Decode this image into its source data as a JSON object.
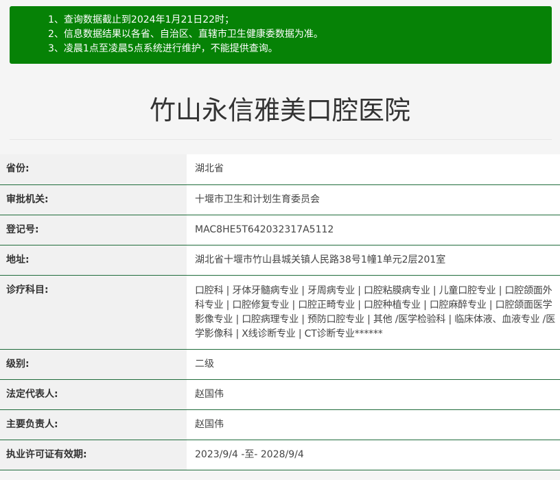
{
  "notice": {
    "lines": [
      "1、查询数据截止到2024年1月21日22时；",
      "2、信息数据结果以各省、自治区、直辖市卫生健康委数据为准。",
      "3、凌晨1点至凌晨5点系统进行维护，不能提供查询。"
    ]
  },
  "title": "竹山永信雅美口腔医院",
  "rows": [
    {
      "label": "省份:",
      "value": "湖北省"
    },
    {
      "label": "审批机关:",
      "value": "十堰市卫生和计划生育委员会"
    },
    {
      "label": "登记号:",
      "value": "MAC8HE5T642032317A5112"
    },
    {
      "label": "地址:",
      "value": "湖北省十堰市竹山县城关镇人民路38号1幢1单元2层201室"
    },
    {
      "label": "诊疗科目:",
      "value": "口腔科 | 牙体牙髓病专业 | 牙周病专业 | 口腔粘膜病专业 | 儿童口腔专业 | 口腔颌面外科专业 | 口腔修复专业 | 口腔正畸专业 | 口腔种植专业 | 口腔麻醉专业 | 口腔颌面医学影像专业 | 口腔病理专业 | 预防口腔专业 | 其他 /医学检验科 | 临床体液、血液专业 /医学影像科 | X线诊断专业 | CT诊断专业******"
    },
    {
      "label": "级别:",
      "value": "二级"
    },
    {
      "label": "法定代表人:",
      "value": "赵国伟"
    },
    {
      "label": "主要负责人:",
      "value": "赵国伟"
    },
    {
      "label": "执业许可证有效期:",
      "value": "2023/9/4 -至- 2028/9/4"
    }
  ]
}
